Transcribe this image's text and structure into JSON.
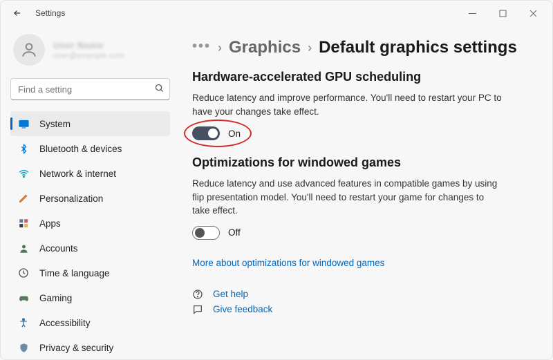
{
  "window": {
    "title": "Settings"
  },
  "profile": {
    "name": "User Name",
    "email": "user@example.com"
  },
  "search": {
    "placeholder": "Find a setting"
  },
  "nav": {
    "system": "System",
    "bluetooth": "Bluetooth & devices",
    "network": "Network & internet",
    "personalization": "Personalization",
    "apps": "Apps",
    "accounts": "Accounts",
    "time": "Time & language",
    "gaming": "Gaming",
    "accessibility": "Accessibility",
    "privacy": "Privacy & security"
  },
  "breadcrumb": {
    "parent": "Graphics",
    "current": "Default graphics settings"
  },
  "gpu": {
    "title": "Hardware-accelerated GPU scheduling",
    "desc": "Reduce latency and improve performance. You'll need to restart your PC to have your changes take effect.",
    "state": "On"
  },
  "opt": {
    "title": "Optimizations for windowed games",
    "desc": "Reduce latency and use advanced features in compatible games by using flip presentation model. You'll need to restart your game for changes to take effect.",
    "state": "Off",
    "link": "More about optimizations for windowed games"
  },
  "help": {
    "get": "Get help",
    "feedback": "Give feedback"
  }
}
